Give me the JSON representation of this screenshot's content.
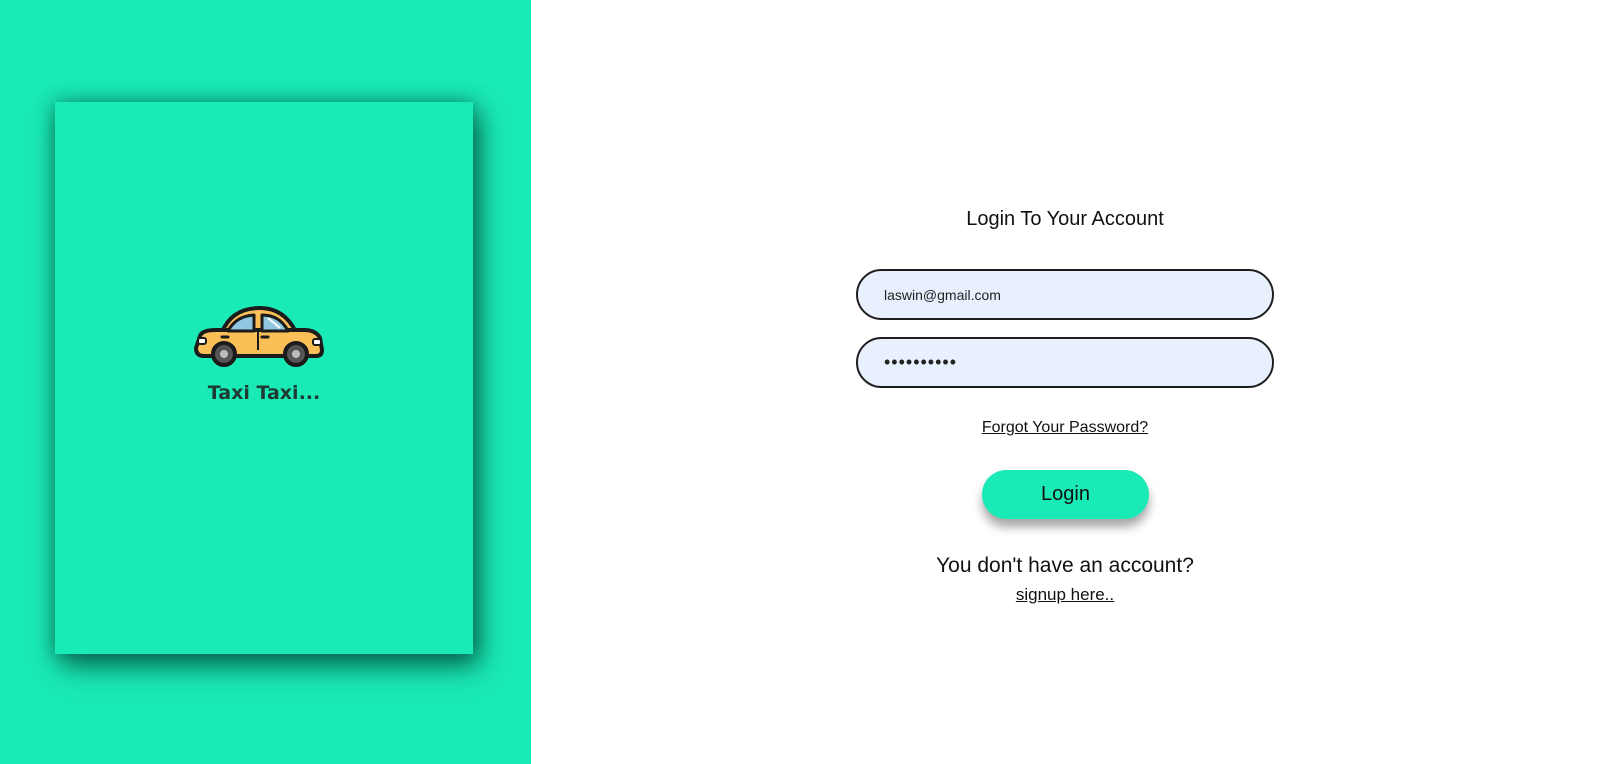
{
  "brand": {
    "name": "Taxi Taxi...",
    "icon": "taxi-car-icon",
    "background_color": "#1aeab6"
  },
  "login": {
    "title": "Login To Your Account",
    "email_value": "laswin@gmail.com",
    "password_value": "••••••••••",
    "forgot_password": "Forgot Your Password?",
    "login_button": "Login",
    "no_account_text": "You don't have an account?",
    "signup_link": "signup here.."
  },
  "colors": {
    "accent": "#1aeab6",
    "input_background": "#e8f0fe",
    "car_body": "#fbbf57"
  }
}
